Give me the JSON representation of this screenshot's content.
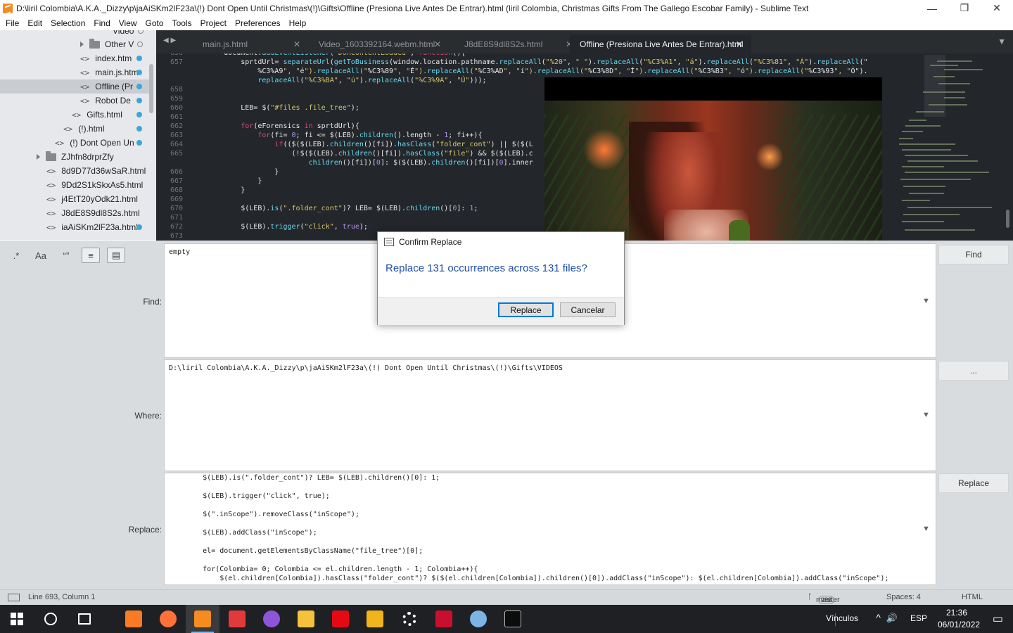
{
  "window": {
    "title": "D:\\liril Colombia\\A.K.A._Dizzy\\p\\jaAiSKm2lF23a\\(!) Dont Open Until Christmas\\(!)\\Gifts\\Offline (Presiona Live Antes De Entrar).html (liril Colombia, Christmas Gifts From The Gallego Escobar Family) - Sublime Text",
    "minimize": "—",
    "restore": "❐",
    "close": "✕"
  },
  "menu": [
    "File",
    "Edit",
    "Selection",
    "Find",
    "View",
    "Goto",
    "Tools",
    "Project",
    "Preferences",
    "Help"
  ],
  "sidebar": {
    "items": [
      {
        "label": "Video",
        "tag": "",
        "kind": "partial"
      },
      {
        "label": "Other V",
        "tag": "",
        "kind": "folder"
      },
      {
        "label": "index.htm",
        "tag": "<>",
        "kind": "file"
      },
      {
        "label": "main.js.htm",
        "tag": "<>",
        "kind": "file"
      },
      {
        "label": "Offline (Pr",
        "tag": "<>",
        "kind": "file"
      },
      {
        "label": "Robot De",
        "tag": "<>",
        "kind": "file"
      },
      {
        "label": "Gifts.html",
        "tag": "<>",
        "kind": "file"
      },
      {
        "label": "(!).html",
        "tag": "<>",
        "kind": "file"
      },
      {
        "label": "(!) Dont Open Un",
        "tag": "<>",
        "kind": "file"
      },
      {
        "label": "ZJhfn8drprZfy",
        "tag": "",
        "kind": "folder"
      },
      {
        "label": "8d9D77d36wSaR.html",
        "tag": "<>",
        "kind": "file"
      },
      {
        "label": "9Dd2S1kSkxAs5.html",
        "tag": "<>",
        "kind": "file"
      },
      {
        "label": "j4EtT20yOdk21.html",
        "tag": "<>",
        "kind": "file"
      },
      {
        "label": "J8dE8S9dl8S2s.html",
        "tag": "<>",
        "kind": "file"
      },
      {
        "label": "iaAiSKm2lF23a.html",
        "tag": "<>",
        "kind": "file"
      }
    ]
  },
  "tabs": [
    {
      "label": "main.js.html",
      "close": "✕"
    },
    {
      "label": "Video_1603392164.webm.html",
      "close": "✕"
    },
    {
      "label": "J8dE8S9dl8S2s.html",
      "close": "✕"
    },
    {
      "label": "Offline (Presiona Live Antes De Entrar).html",
      "close": "✕"
    }
  ],
  "tab_arrows": "◀ ▶",
  "tab_menu": "▼",
  "editor": {
    "line_numbers": [
      "656",
      "657",
      "",
      "",
      "658",
      "659",
      "660",
      "661",
      "662",
      "663",
      "664",
      "665",
      "",
      "666",
      "667",
      "668",
      "669",
      "670",
      "671",
      "672",
      "673"
    ],
    "lines": [
      "        document.addEventListener(\"DOMContentLoaded\", function(){",
      "            sprtdUrl= separateUrl(getToBusiness(window.location.pathname.replaceAll(\"%20\", \" \").replaceAll(\"%C3%A1\", \"á\").replaceAll(\"%C3%81\", \"Á\").replaceAll(\"",
      "                %C3%A9\", \"é\").replaceAll(\"%C3%89\", \"É\").replaceAll(\"%C3%AD\", \"í\").replaceAll(\"%C3%8D\", \"Í\").replaceAll(\"%C3%B3\", \"ó\").replaceAll(\"%C3%93\", \"Ó\").",
      "                replaceAll(\"%C3%BA\", \"ú\").replaceAll(\"%C3%9A\", \"Ú\")));",
      "",
      "",
      "            LEB= $(\"#files .file_tree\");",
      "",
      "            for(eForensics in sprtdUrl){",
      "                for(fi= 0; fi <= $(LEB).children().length - 1; fi++){",
      "                    if(($($(LEB).children()[fi]).hasClass(\"folder_cont\") || $($(L",
      "                        (!$($(LEB).children()[fi]).hasClass(\"file\") && $($(LEB).c",
      "                            children()[fi])[0]: $($(LEB).children()[fi])[0].inner",
      "                    }",
      "                }",
      "            }",
      "",
      "            $(LEB).is(\".folder_cont\")? LEB= $(LEB).children()[0]: 1;",
      "",
      "            $(LEB).trigger(\"click\", true);",
      ""
    ]
  },
  "find": {
    "options": [
      ".*",
      "Aa",
      "“”",
      "≡",
      "▤"
    ],
    "find_label": "Find:",
    "find_value": "empty",
    "where_label": "Where:",
    "where_value": "D:\\liril Colombia\\A.K.A._Dizzy\\p\\jaAiSKm2lF23a\\(!) Dont Open Until Christmas\\(!)\\Gifts\\VIDEOS",
    "replace_label": "Replace:",
    "replace_value": "        $(LEB).is(\".folder_cont\")? LEB= $(LEB).children()[0]: 1;\n\n        $(LEB).trigger(\"click\", true);\n\n        $(\".inScope\").removeClass(\"inScope\");\n\n        $(LEB).addClass(\"inScope\");\n\n        el= document.getElementsByClassName(\"file_tree\")[0];\n\n        for(Colombia= 0; Colombia <= el.children.length - 1; Colombia++){\n            $(el.children[Colombia]).hasClass(\"folder_cont\")? $($(el.children[Colombia]).children()[0]).addClass(\"inScope\"): $(el.children[Colombia]).addClass(\"inScope\");",
    "dropdown": "▼",
    "find_button": "Find",
    "where_button": "...",
    "replace_button": "Replace"
  },
  "dialog": {
    "title": "Confirm Replace",
    "message": "Replace 131 occurrences across 131 files?",
    "ok": "Replace",
    "cancel": "Cancelar"
  },
  "status": {
    "position": "Line 693, Column 1",
    "branch": "master",
    "branch_count": "288",
    "indent": "Spaces: 4",
    "syntax": "HTML"
  },
  "taskbar": {
    "lang": "ESP",
    "time": "21:36",
    "date": "06/01/2022",
    "links": "Vínculos",
    "tray_up": "^",
    "volume": "🔊",
    "notify": "▭",
    "apps": [
      {
        "name": "windows-start",
        "color": "#ffffff"
      },
      {
        "name": "search",
        "color": "#ffffff"
      },
      {
        "name": "task-view",
        "color": "#ffffff"
      },
      {
        "name": "xampp",
        "color": "#fb7a24"
      },
      {
        "name": "firefox",
        "color": "#ff7139"
      },
      {
        "name": "sublime-text",
        "color": "#f68b1f"
      },
      {
        "name": "popcorn",
        "color": "#e23a3a"
      },
      {
        "name": "github-desktop",
        "color": "#8e55d9"
      },
      {
        "name": "file-explorer",
        "color": "#f5c23b"
      },
      {
        "name": "netflix",
        "color": "#e50914"
      },
      {
        "name": "winamp",
        "color": "#f2b41b"
      },
      {
        "name": "settings",
        "color": "#ffffff"
      },
      {
        "name": "flash",
        "color": "#c8102e"
      },
      {
        "name": "paint",
        "color": "#7db4e6"
      },
      {
        "name": "terminal",
        "color": "#0c0c0c"
      }
    ]
  }
}
